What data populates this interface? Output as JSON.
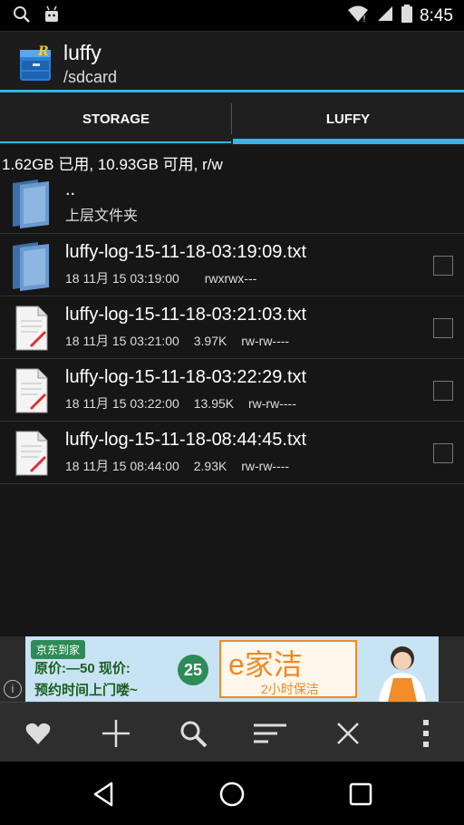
{
  "status_bar": {
    "time": "8:45"
  },
  "app_bar": {
    "title": "luffy",
    "subtitle": "/sdcard"
  },
  "tabs": [
    {
      "label": "STORAGE",
      "selected": false
    },
    {
      "label": "LUFFY",
      "selected": true
    }
  ],
  "storage_info": "1.62GB 已用, 10.93GB 可用, r/w",
  "parent_entry": {
    "name": "..",
    "desc": "上层文件夹"
  },
  "files": [
    {
      "name": "luffy-log-15-11-18-03:19:09.txt",
      "date": "18 11月 15 03:19:00",
      "size": "",
      "perms": "rwxrwx---",
      "icon": "folder-icon"
    },
    {
      "name": "luffy-log-15-11-18-03:21:03.txt",
      "date": "18 11月 15 03:21:00",
      "size": "3.97K",
      "perms": "rw-rw----",
      "icon": "text-file-icon"
    },
    {
      "name": "luffy-log-15-11-18-03:22:29.txt",
      "date": "18 11月 15 03:22:00",
      "size": "13.95K",
      "perms": "rw-rw----",
      "icon": "text-file-icon"
    },
    {
      "name": "luffy-log-15-11-18-08:44:45.txt",
      "date": "18 11月 15 08:44:00",
      "size": "2.93K",
      "perms": "rw-rw----",
      "icon": "text-file-icon"
    }
  ],
  "ad": {
    "brand": "京东到家",
    "line1": "原价:—50 现价:",
    "line2": "预约时间上门喽~",
    "badge": "25",
    "box_title": "e家洁",
    "box_sub": "2小时保洁",
    "info_label": "i"
  },
  "colors": {
    "accent": "#33b5e5",
    "background": "#161616",
    "toolbar": "#2e2e2e"
  }
}
